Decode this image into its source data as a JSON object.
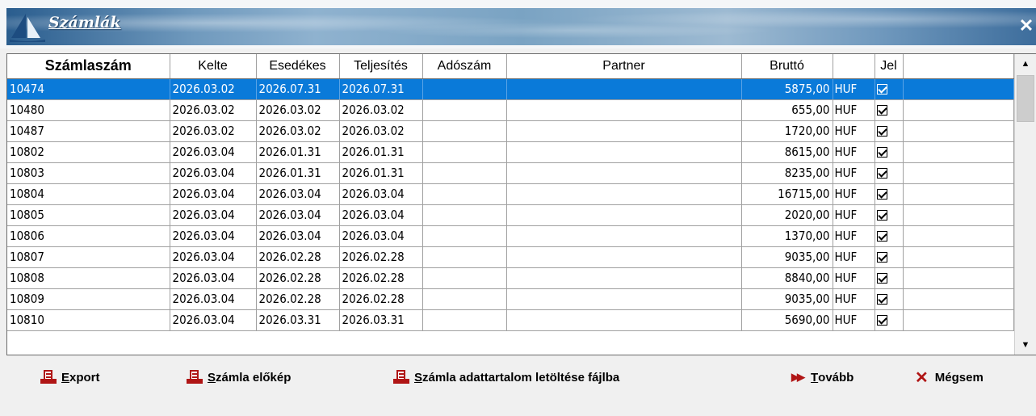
{
  "window": {
    "title": "Számlák"
  },
  "columns": [
    "Számlaszám",
    "Kelte",
    "Esedékes",
    "Teljesítés",
    "Adószám",
    "Partner",
    "Bruttó",
    "",
    "Jel",
    ""
  ],
  "rows": [
    {
      "szamlaszam": "10474",
      "kelte": "2026.03.02",
      "esedekes": "2026.07.31",
      "teljesites": "2026.07.31",
      "adoszam": "",
      "partner": "",
      "brutto": "5875,00",
      "penznem": "HUF",
      "jel": true,
      "selected": true
    },
    {
      "szamlaszam": "10480",
      "kelte": "2026.03.02",
      "esedekes": "2026.03.02",
      "teljesites": "2026.03.02",
      "adoszam": "",
      "partner": "",
      "brutto": "655,00",
      "penznem": "HUF",
      "jel": true
    },
    {
      "szamlaszam": "10487",
      "kelte": "2026.03.02",
      "esedekes": "2026.03.02",
      "teljesites": "2026.03.02",
      "adoszam": "",
      "partner": "",
      "brutto": "1720,00",
      "penznem": "HUF",
      "jel": true
    },
    {
      "szamlaszam": "10802",
      "kelte": "2026.03.04",
      "esedekes": "2026.01.31",
      "teljesites": "2026.01.31",
      "adoszam": "",
      "partner": "",
      "brutto": "8615,00",
      "penznem": "HUF",
      "jel": true
    },
    {
      "szamlaszam": "10803",
      "kelte": "2026.03.04",
      "esedekes": "2026.01.31",
      "teljesites": "2026.01.31",
      "adoszam": "",
      "partner": "",
      "brutto": "8235,00",
      "penznem": "HUF",
      "jel": true
    },
    {
      "szamlaszam": "10804",
      "kelte": "2026.03.04",
      "esedekes": "2026.03.04",
      "teljesites": "2026.03.04",
      "adoszam": "",
      "partner": "",
      "brutto": "16715,00",
      "penznem": "HUF",
      "jel": true
    },
    {
      "szamlaszam": "10805",
      "kelte": "2026.03.04",
      "esedekes": "2026.03.04",
      "teljesites": "2026.03.04",
      "adoszam": "",
      "partner": "",
      "brutto": "2020,00",
      "penznem": "HUF",
      "jel": true
    },
    {
      "szamlaszam": "10806",
      "kelte": "2026.03.04",
      "esedekes": "2026.03.04",
      "teljesites": "2026.03.04",
      "adoszam": "",
      "partner": "",
      "brutto": "1370,00",
      "penznem": "HUF",
      "jel": true
    },
    {
      "szamlaszam": "10807",
      "kelte": "2026.03.04",
      "esedekes": "2026.02.28",
      "teljesites": "2026.02.28",
      "adoszam": "",
      "partner": "",
      "brutto": "9035,00",
      "penznem": "HUF",
      "jel": true
    },
    {
      "szamlaszam": "10808",
      "kelte": "2026.03.04",
      "esedekes": "2026.02.28",
      "teljesites": "2026.02.28",
      "adoszam": "",
      "partner": "",
      "brutto": "8840,00",
      "penznem": "HUF",
      "jel": true
    },
    {
      "szamlaszam": "10809",
      "kelte": "2026.03.04",
      "esedekes": "2026.02.28",
      "teljesites": "2026.02.28",
      "adoszam": "",
      "partner": "",
      "brutto": "9035,00",
      "penznem": "HUF",
      "jel": true
    },
    {
      "szamlaszam": "10810",
      "kelte": "2026.03.04",
      "esedekes": "2026.03.31",
      "teljesites": "2026.03.31",
      "adoszam": "",
      "partner": "",
      "brutto": "5690,00",
      "penznem": "HUF",
      "jel": true
    }
  ],
  "footer": {
    "export_pre": "",
    "export_key": "E",
    "export_post": "xport",
    "preview_pre": "",
    "preview_key": "S",
    "preview_post": "zámla előkép",
    "download_pre": "",
    "download_key": "S",
    "download_post": "zámla adattartalom letöltése fájlba",
    "next_pre": "",
    "next_key": "T",
    "next_post": "ovább",
    "cancel_label": "Mégsem"
  },
  "colors": {
    "selection": "#0a7ad9",
    "icon_red": "#b01515",
    "title_band": "#6f99bd"
  },
  "icons": {
    "close": "close-icon",
    "export": "document-icon",
    "preview": "document-icon",
    "download": "document-icon",
    "next": "fast-forward-icon",
    "cancel": "x-icon"
  }
}
